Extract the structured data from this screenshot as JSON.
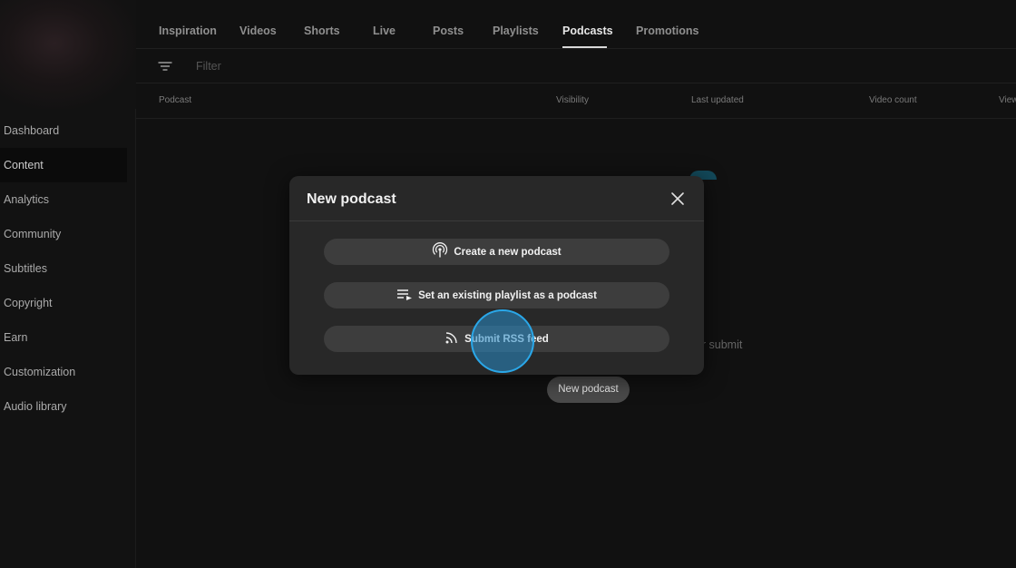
{
  "sidebar": {
    "items": [
      {
        "label": "Dashboard"
      },
      {
        "label": "Content"
      },
      {
        "label": "Analytics"
      },
      {
        "label": "Community"
      },
      {
        "label": "Subtitles"
      },
      {
        "label": "Copyright"
      },
      {
        "label": "Earn"
      },
      {
        "label": "Customization"
      },
      {
        "label": "Audio library"
      }
    ],
    "active_item": "Content"
  },
  "tabs": [
    {
      "label": "Inspiration"
    },
    {
      "label": "Videos"
    },
    {
      "label": "Shorts"
    },
    {
      "label": "Live"
    },
    {
      "label": "Posts"
    },
    {
      "label": "Playlists"
    },
    {
      "label": "Podcasts"
    },
    {
      "label": "Promotions"
    }
  ],
  "active_tab": "Podcasts",
  "filter": {
    "placeholder": "Filter"
  },
  "table": {
    "columns": [
      "Podcast",
      "Visibility",
      "Last updated",
      "Video count",
      "Views"
    ]
  },
  "empty_state": {
    "text_visible": ", or submit",
    "button_label": "New podcast"
  },
  "modal": {
    "title": "New podcast",
    "options": [
      {
        "label": "Create a new podcast",
        "icon": "podcast-icon"
      },
      {
        "label": "Set an existing playlist as a podcast",
        "icon": "playlist-icon"
      },
      {
        "label": "Submit RSS feed",
        "icon": "rss-icon"
      }
    ],
    "close_icon": "close-icon"
  },
  "colors": {
    "background": "#101010",
    "modal_background": "#282828",
    "button_background": "#3d3d3d",
    "click_indicator": "#2aa7e8"
  }
}
